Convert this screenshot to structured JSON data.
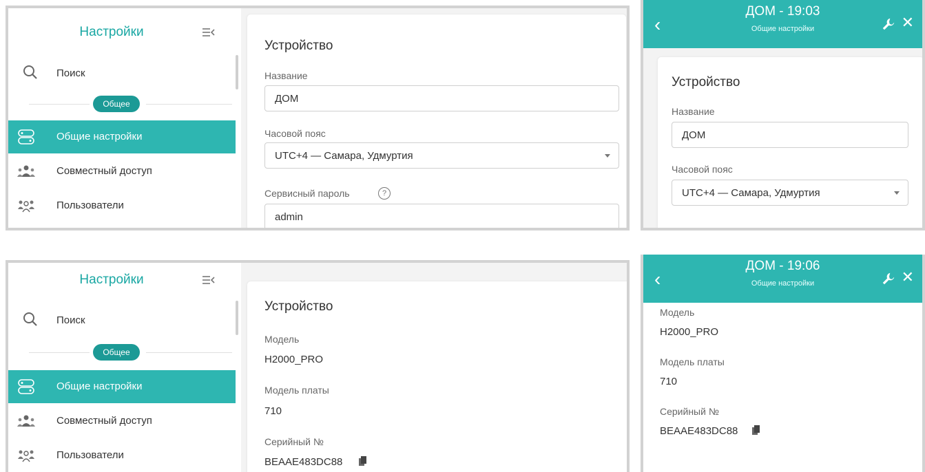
{
  "settings": {
    "title": "Настройки",
    "search": "Поиск",
    "group": "Общее",
    "nav": [
      "Общие настройки",
      "Совместный доступ",
      "Пользователи"
    ]
  },
  "device": {
    "heading": "Устройство",
    "name_label": "Название",
    "name_value": "ДОМ",
    "tz_label": "Часовой пояс",
    "tz_value": "UTC+4 — Самара, Удмуртия",
    "pass_label": "Сервисный пароль",
    "pass_help": "?",
    "pass_value": "admin",
    "model_label": "Модель",
    "model_value": "H2000_PRO",
    "board_label": "Модель платы",
    "board_value": "710",
    "serial_label": "Серийный №",
    "serial_value": "BEAAE483DC88"
  },
  "mobile1": {
    "title": "ДОМ - 19:03",
    "subtitle": "Общие настройки"
  },
  "mobile2": {
    "title": "ДОМ - 19:06",
    "subtitle": "Общие настройки"
  },
  "icons": [
    "search-icon",
    "collapse-menu-icon",
    "general-settings-icon",
    "shared-access-icon",
    "users-icon",
    "help-icon",
    "copy-icon",
    "back-icon",
    "wrench-icon",
    "close-icon",
    "dropdown-caret-icon"
  ],
  "colors": {
    "accent": "#2eb6b1",
    "accent_dark": "#1c9a96",
    "title_teal": "#19a7a3",
    "frame": "#d2d2d2"
  }
}
